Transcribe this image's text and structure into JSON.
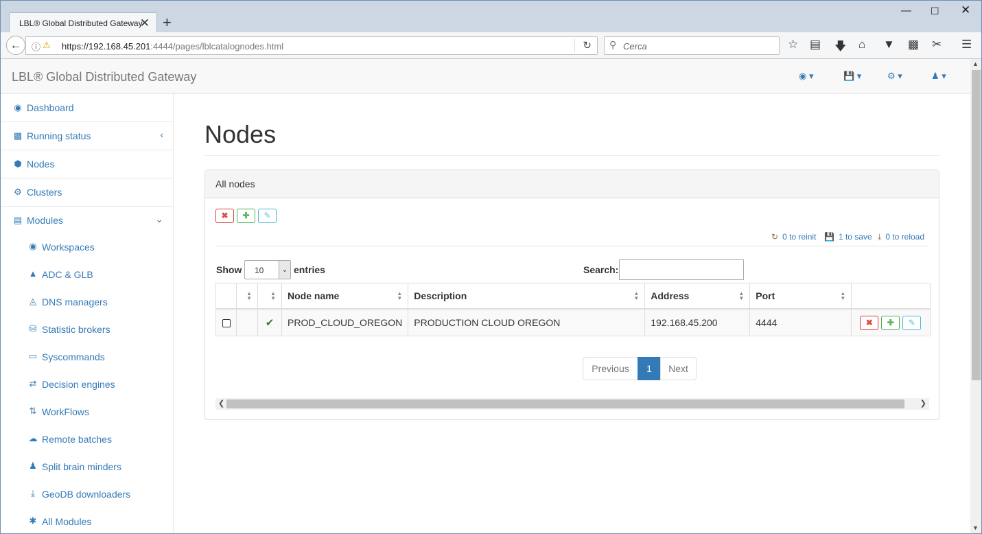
{
  "browser": {
    "tab_title": "LBL® Global Distributed Gateway",
    "tab_close": "✕",
    "new_tab": "+",
    "url_host": "https://192.168.45.201",
    "url_rest": ":4444/pages/lblcatalognodes.html",
    "search_placeholder": "Cerca",
    "icons": [
      "back-icon",
      "info-icon",
      "lock-warning-icon",
      "reload-icon",
      "search-icon",
      "star-icon",
      "reading-list-icon",
      "download-icon",
      "home-icon",
      "pocket-icon",
      "zip-icon",
      "screenshot-icon",
      "menu-icon"
    ]
  },
  "app": {
    "brand": "LBL® Global Distributed Gateway",
    "top_icons": [
      "dashboard-icon",
      "save-icon",
      "gear-icon",
      "user-icon"
    ]
  },
  "sidebar": {
    "items": [
      {
        "label": "Dashboard",
        "icon": "dashboard-icon"
      },
      {
        "label": "Running status",
        "icon": "bar-chart-icon"
      },
      {
        "label": "Nodes",
        "icon": "cube-icon"
      },
      {
        "label": "Clusters",
        "icon": "cogs-icon"
      },
      {
        "label": "Modules",
        "icon": "list-icon"
      }
    ],
    "subitems": [
      {
        "label": "Workspaces",
        "icon": "dashboard-icon"
      },
      {
        "label": "ADC & GLB",
        "icon": "sitemap-icon"
      },
      {
        "label": "DNS managers",
        "icon": "binoculars-icon"
      },
      {
        "label": "Statistic brokers",
        "icon": "database-icon"
      },
      {
        "label": "Syscommands",
        "icon": "laptop-icon"
      },
      {
        "label": "Decision engines",
        "icon": "random-icon"
      },
      {
        "label": "WorkFlows",
        "icon": "sort-alpha-icon"
      },
      {
        "label": "Remote batches",
        "icon": "cloud-upload-icon"
      },
      {
        "label": "Split brain minders",
        "icon": "users-icon"
      },
      {
        "label": "GeoDB downloaders",
        "icon": "download-icon"
      },
      {
        "label": "All Modules",
        "icon": "asterisk-icon"
      }
    ]
  },
  "main": {
    "title": "Nodes",
    "panel_title": "All nodes",
    "status": {
      "reinit": "0 to reinit",
      "save": "1 to save",
      "reload": "0 to reload"
    },
    "length": {
      "show": "Show",
      "value": "10",
      "entries": "entries"
    },
    "search_label": "Search:",
    "table": {
      "columns": [
        "",
        "",
        "",
        "Node name",
        "Description",
        "Address",
        "Port",
        ""
      ],
      "rows": [
        {
          "node_name": "PROD_CLOUD_OREGON",
          "description": "PRODUCTION CLOUD OREGON",
          "address": "192.168.45.200",
          "port": "4444",
          "checked": true
        }
      ]
    },
    "pagination": {
      "previous": "Previous",
      "current": "1",
      "next": "Next"
    }
  },
  "colors": {
    "link": "#337ab7",
    "danger": "#d9534f",
    "success": "#5cb85c",
    "info": "#5bc0de"
  }
}
